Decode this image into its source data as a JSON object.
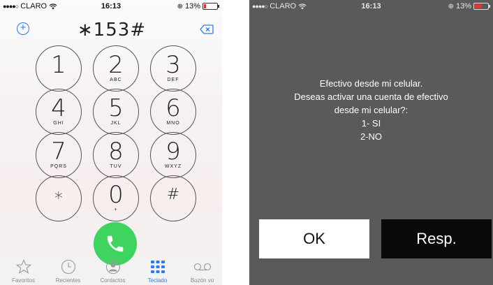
{
  "left_phone": {
    "status_bar": {
      "signal": "●●●●○",
      "carrier": "CLARO",
      "time": "16:13",
      "battery": "13%"
    },
    "dial_number": "∗153#",
    "keypad": [
      {
        "digit": "1",
        "letters": ""
      },
      {
        "digit": "2",
        "letters": "ABC"
      },
      {
        "digit": "3",
        "letters": "DEF"
      },
      {
        "digit": "4",
        "letters": "GHI"
      },
      {
        "digit": "5",
        "letters": "JKL"
      },
      {
        "digit": "6",
        "letters": "MNO"
      },
      {
        "digit": "7",
        "letters": "PQRS"
      },
      {
        "digit": "8",
        "letters": "TUV"
      },
      {
        "digit": "9",
        "letters": "WXYZ"
      },
      {
        "digit": "∗",
        "letters": ""
      },
      {
        "digit": "0",
        "letters": "+"
      },
      {
        "digit": "#",
        "letters": ""
      }
    ],
    "tabs": [
      {
        "label": "Favoritos",
        "icon": "star-icon"
      },
      {
        "label": "Recientes",
        "icon": "clock-icon"
      },
      {
        "label": "Contactos",
        "icon": "contact-icon"
      },
      {
        "label": "Teclado",
        "icon": "keypad-icon",
        "active": true
      },
      {
        "label": "Buzón vo",
        "icon": "voicemail-icon"
      }
    ],
    "accent_color": "#2a7bf0",
    "call_color": "#3fd360"
  },
  "right_phone": {
    "status_bar": {
      "signal": "●●●●○",
      "carrier": "CLARO",
      "time": "16:13",
      "battery": "13%"
    },
    "message_lines": [
      "Efectivo desde mi celular.",
      "Deseas activar una cuenta de efectivo",
      "desde mi celular?:",
      "1- SI",
      "2-NO"
    ],
    "ok_label": "OK",
    "resp_label": "Resp."
  }
}
